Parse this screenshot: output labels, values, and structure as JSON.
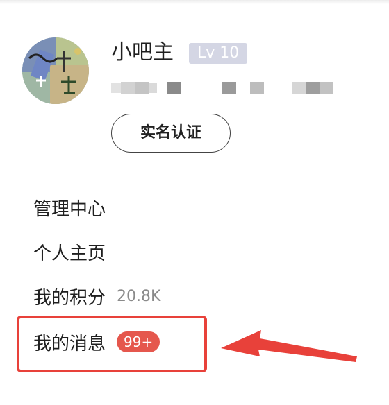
{
  "profile": {
    "username": "小吧主",
    "level": "Lv 10",
    "verify_label": "实名认证"
  },
  "menu": {
    "items": [
      {
        "label": "管理中心"
      },
      {
        "label": "个人主页"
      },
      {
        "label": "我的积分",
        "count": "20.8K"
      },
      {
        "label": "我的消息",
        "badge": "99+"
      }
    ]
  },
  "colors": {
    "highlight": "#e8413a",
    "badge": "#e5574d",
    "level_badge": "#d4d6e4"
  }
}
